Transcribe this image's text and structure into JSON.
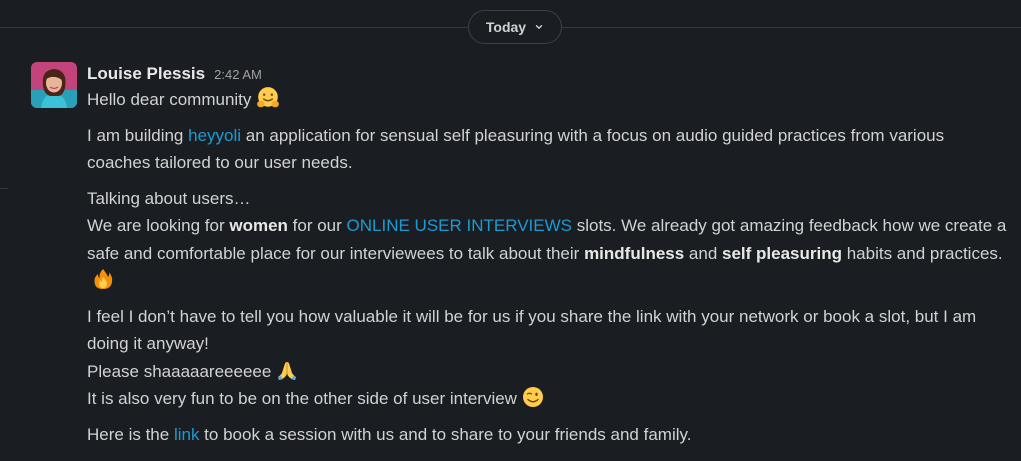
{
  "divider": {
    "date_label": "Today"
  },
  "message": {
    "author": "Louise Plessis",
    "timestamp": "2:42 AM",
    "greeting": "Hello dear community",
    "p1_pre": "I am building ",
    "p1_link": "heyyoli",
    "p1_post": " an application for sensual self pleasuring with a focus on audio guided practices from various coaches tailored to our user needs.",
    "p2_line1": "Talking about users…",
    "p2_a": "We are looking for ",
    "p2_b": "women",
    "p2_c": " for our ",
    "p2_link": "ONLINE USER INTERVIEWS",
    "p2_d": " slots. We already got amazing feedback how we create a safe and comfortable place for our interviewees to talk about their ",
    "p2_e": "mindfulness",
    "p2_f": " and ",
    "p2_g": "self pleasuring",
    "p2_h": " habits and practices.",
    "p3_line1": "I feel I don’t have to tell you how valuable it will be for us if you share the link with your network or book a slot, but I am doing it anyway!",
    "p3_line2": "Please shaaaaareeeeee",
    "p3_line3": "It is also very fun to be on the other side of user interview",
    "p4_pre": "Here is the ",
    "p4_link": "link",
    "p4_post": " to book a session with us and to share to your friends and family."
  },
  "icons": {
    "hug": "hugging-face-emoji",
    "fire": "fire-emoji",
    "pray": "folded-hands-emoji",
    "wink": "winking-face-emoji",
    "chevron": "chevron-down-icon"
  },
  "colors": {
    "background": "#1a1d21",
    "text": "#d1d2d3",
    "link": "#1d9bd1",
    "divider": "#35373b"
  }
}
